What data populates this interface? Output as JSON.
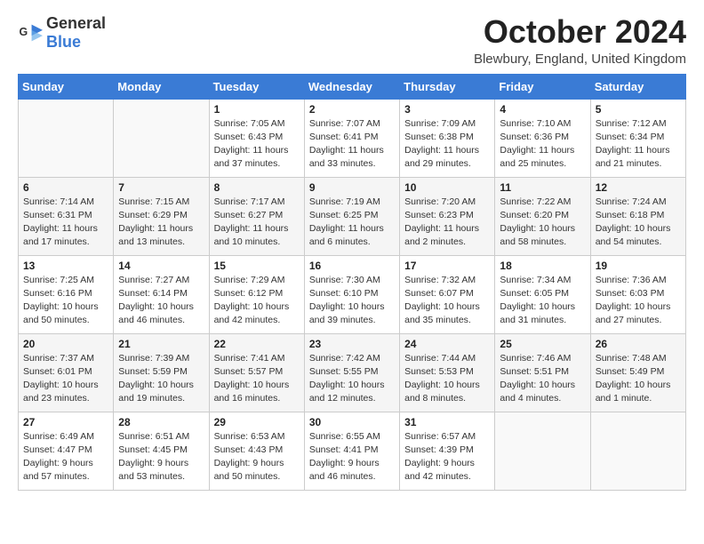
{
  "header": {
    "logo_general": "General",
    "logo_blue": "Blue",
    "month_title": "October 2024",
    "location": "Blewbury, England, United Kingdom"
  },
  "days_of_week": [
    "Sunday",
    "Monday",
    "Tuesday",
    "Wednesday",
    "Thursday",
    "Friday",
    "Saturday"
  ],
  "weeks": [
    [
      {
        "day": "",
        "info": ""
      },
      {
        "day": "",
        "info": ""
      },
      {
        "day": "1",
        "info": "Sunrise: 7:05 AM\nSunset: 6:43 PM\nDaylight: 11 hours\nand 37 minutes."
      },
      {
        "day": "2",
        "info": "Sunrise: 7:07 AM\nSunset: 6:41 PM\nDaylight: 11 hours\nand 33 minutes."
      },
      {
        "day": "3",
        "info": "Sunrise: 7:09 AM\nSunset: 6:38 PM\nDaylight: 11 hours\nand 29 minutes."
      },
      {
        "day": "4",
        "info": "Sunrise: 7:10 AM\nSunset: 6:36 PM\nDaylight: 11 hours\nand 25 minutes."
      },
      {
        "day": "5",
        "info": "Sunrise: 7:12 AM\nSunset: 6:34 PM\nDaylight: 11 hours\nand 21 minutes."
      }
    ],
    [
      {
        "day": "6",
        "info": "Sunrise: 7:14 AM\nSunset: 6:31 PM\nDaylight: 11 hours\nand 17 minutes."
      },
      {
        "day": "7",
        "info": "Sunrise: 7:15 AM\nSunset: 6:29 PM\nDaylight: 11 hours\nand 13 minutes."
      },
      {
        "day": "8",
        "info": "Sunrise: 7:17 AM\nSunset: 6:27 PM\nDaylight: 11 hours\nand 10 minutes."
      },
      {
        "day": "9",
        "info": "Sunrise: 7:19 AM\nSunset: 6:25 PM\nDaylight: 11 hours\nand 6 minutes."
      },
      {
        "day": "10",
        "info": "Sunrise: 7:20 AM\nSunset: 6:23 PM\nDaylight: 11 hours\nand 2 minutes."
      },
      {
        "day": "11",
        "info": "Sunrise: 7:22 AM\nSunset: 6:20 PM\nDaylight: 10 hours\nand 58 minutes."
      },
      {
        "day": "12",
        "info": "Sunrise: 7:24 AM\nSunset: 6:18 PM\nDaylight: 10 hours\nand 54 minutes."
      }
    ],
    [
      {
        "day": "13",
        "info": "Sunrise: 7:25 AM\nSunset: 6:16 PM\nDaylight: 10 hours\nand 50 minutes."
      },
      {
        "day": "14",
        "info": "Sunrise: 7:27 AM\nSunset: 6:14 PM\nDaylight: 10 hours\nand 46 minutes."
      },
      {
        "day": "15",
        "info": "Sunrise: 7:29 AM\nSunset: 6:12 PM\nDaylight: 10 hours\nand 42 minutes."
      },
      {
        "day": "16",
        "info": "Sunrise: 7:30 AM\nSunset: 6:10 PM\nDaylight: 10 hours\nand 39 minutes."
      },
      {
        "day": "17",
        "info": "Sunrise: 7:32 AM\nSunset: 6:07 PM\nDaylight: 10 hours\nand 35 minutes."
      },
      {
        "day": "18",
        "info": "Sunrise: 7:34 AM\nSunset: 6:05 PM\nDaylight: 10 hours\nand 31 minutes."
      },
      {
        "day": "19",
        "info": "Sunrise: 7:36 AM\nSunset: 6:03 PM\nDaylight: 10 hours\nand 27 minutes."
      }
    ],
    [
      {
        "day": "20",
        "info": "Sunrise: 7:37 AM\nSunset: 6:01 PM\nDaylight: 10 hours\nand 23 minutes."
      },
      {
        "day": "21",
        "info": "Sunrise: 7:39 AM\nSunset: 5:59 PM\nDaylight: 10 hours\nand 19 minutes."
      },
      {
        "day": "22",
        "info": "Sunrise: 7:41 AM\nSunset: 5:57 PM\nDaylight: 10 hours\nand 16 minutes."
      },
      {
        "day": "23",
        "info": "Sunrise: 7:42 AM\nSunset: 5:55 PM\nDaylight: 10 hours\nand 12 minutes."
      },
      {
        "day": "24",
        "info": "Sunrise: 7:44 AM\nSunset: 5:53 PM\nDaylight: 10 hours\nand 8 minutes."
      },
      {
        "day": "25",
        "info": "Sunrise: 7:46 AM\nSunset: 5:51 PM\nDaylight: 10 hours\nand 4 minutes."
      },
      {
        "day": "26",
        "info": "Sunrise: 7:48 AM\nSunset: 5:49 PM\nDaylight: 10 hours\nand 1 minute."
      }
    ],
    [
      {
        "day": "27",
        "info": "Sunrise: 6:49 AM\nSunset: 4:47 PM\nDaylight: 9 hours\nand 57 minutes."
      },
      {
        "day": "28",
        "info": "Sunrise: 6:51 AM\nSunset: 4:45 PM\nDaylight: 9 hours\nand 53 minutes."
      },
      {
        "day": "29",
        "info": "Sunrise: 6:53 AM\nSunset: 4:43 PM\nDaylight: 9 hours\nand 50 minutes."
      },
      {
        "day": "30",
        "info": "Sunrise: 6:55 AM\nSunset: 4:41 PM\nDaylight: 9 hours\nand 46 minutes."
      },
      {
        "day": "31",
        "info": "Sunrise: 6:57 AM\nSunset: 4:39 PM\nDaylight: 9 hours\nand 42 minutes."
      },
      {
        "day": "",
        "info": ""
      },
      {
        "day": "",
        "info": ""
      }
    ]
  ]
}
